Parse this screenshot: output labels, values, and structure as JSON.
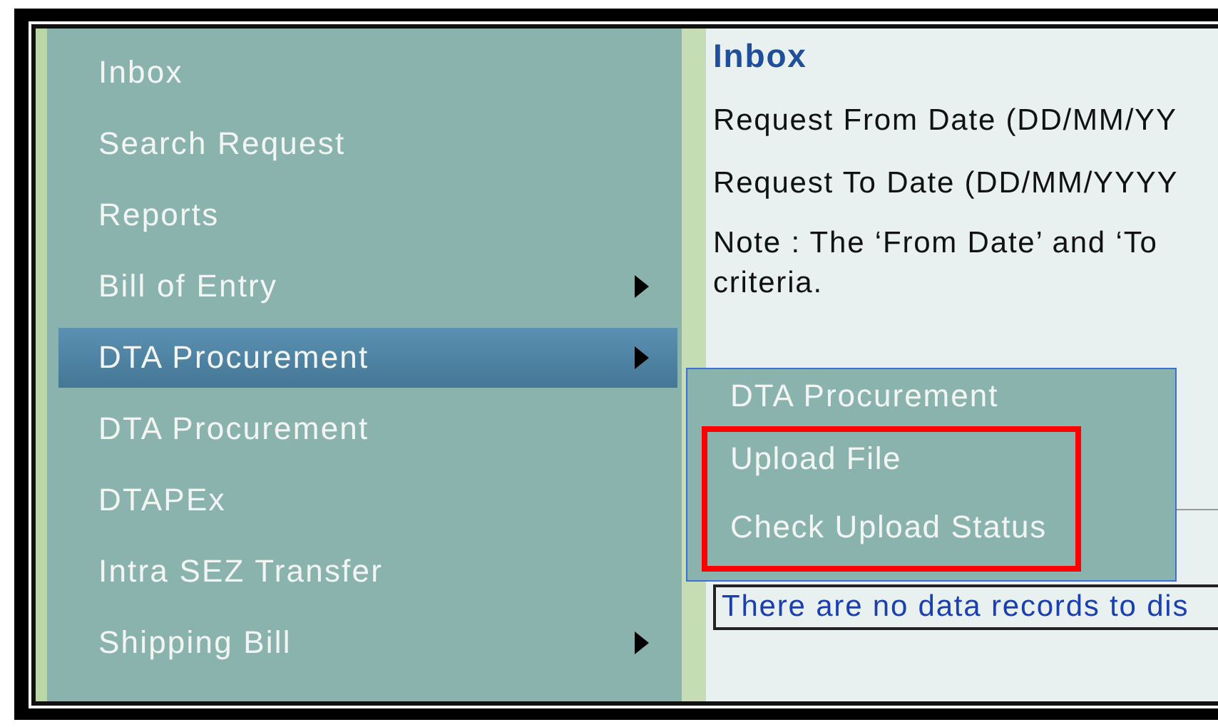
{
  "sidebar": {
    "items": [
      {
        "label": "Inbox",
        "selected": false,
        "has_submenu": false
      },
      {
        "label": "Search Request",
        "selected": false,
        "has_submenu": false
      },
      {
        "label": "Reports",
        "selected": false,
        "has_submenu": false
      },
      {
        "label": "Bill of Entry",
        "selected": false,
        "has_submenu": true
      },
      {
        "label": "DTA Procurement",
        "selected": true,
        "has_submenu": true
      },
      {
        "label": "DTA Procurement",
        "selected": false,
        "has_submenu": false
      },
      {
        "label": "DTAPEx",
        "selected": false,
        "has_submenu": false
      },
      {
        "label": "Intra SEZ Transfer",
        "selected": false,
        "has_submenu": false
      },
      {
        "label": "Shipping Bill",
        "selected": false,
        "has_submenu": true
      }
    ]
  },
  "content": {
    "title": "Inbox",
    "lines": [
      "Request From Date (DD/MM/YY",
      "Request To Date (DD/MM/YYYY",
      "Note : The ‘From Date’ and ‘To",
      "criteria."
    ],
    "empty_message": "There are no data records to dis"
  },
  "submenu": {
    "title": "DTA Procurement",
    "highlighted": true,
    "items": [
      {
        "label": "Upload File"
      },
      {
        "label": "Check Upload Status"
      }
    ]
  }
}
